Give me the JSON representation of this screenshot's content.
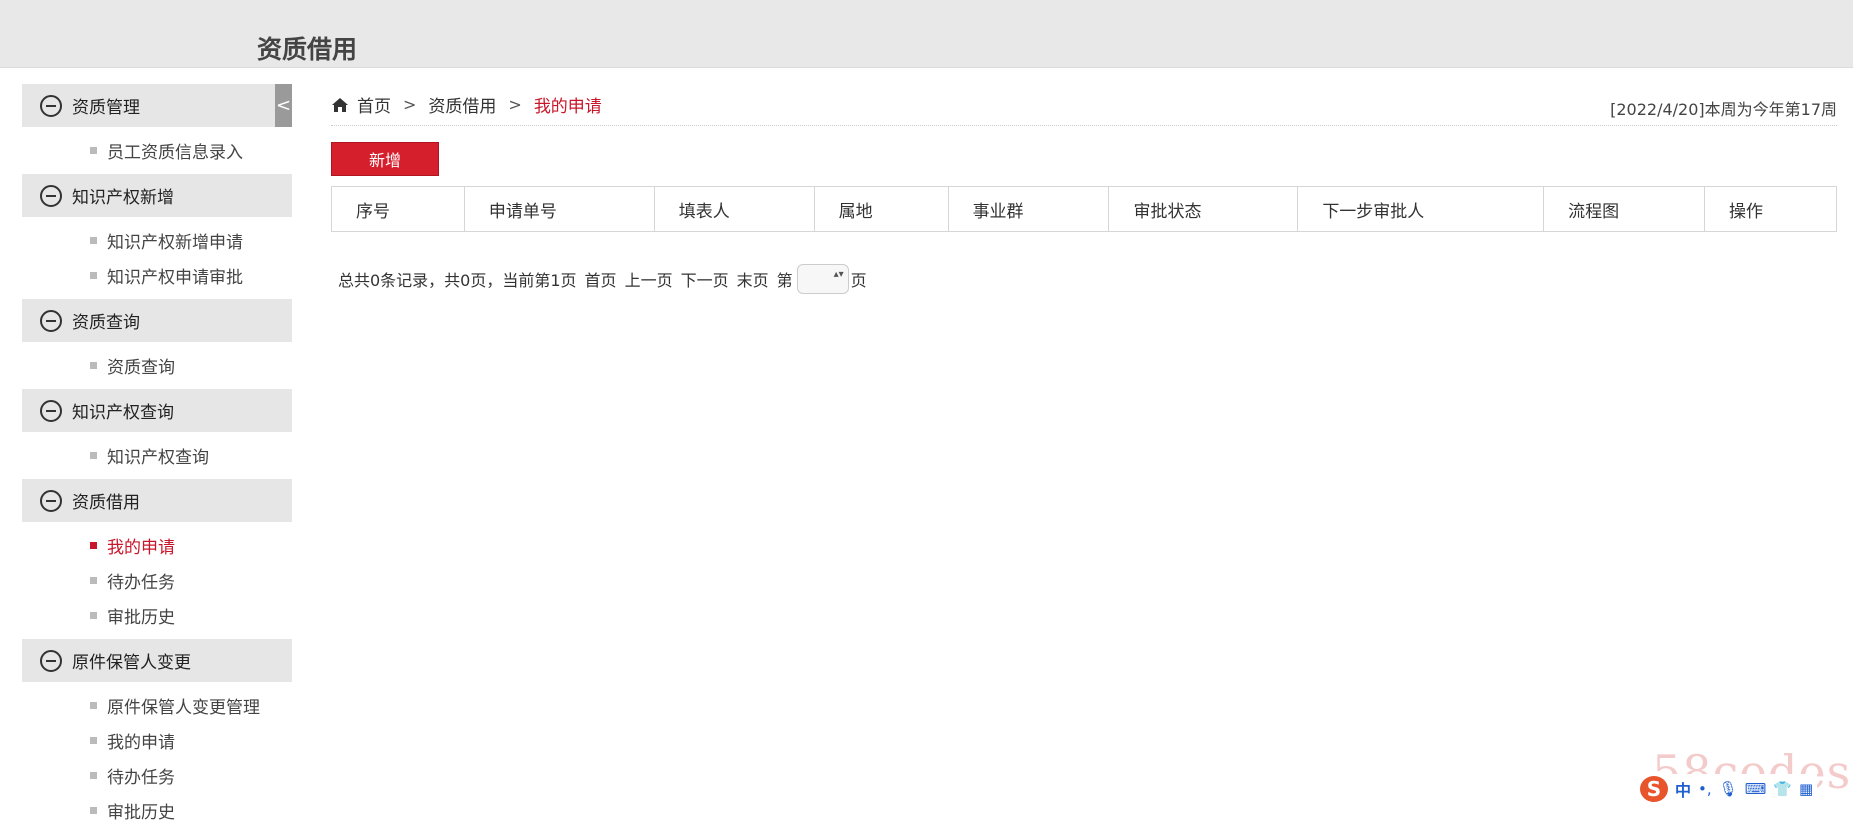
{
  "app_title": "资质借用",
  "sidebar": {
    "collapse_label": "<",
    "groups": [
      {
        "label": "资质管理",
        "items": [
          "员工资质信息录入"
        ]
      },
      {
        "label": "知识产权新增",
        "items": [
          "知识产权新增申请",
          "知识产权申请审批"
        ]
      },
      {
        "label": "资质查询",
        "items": [
          "资质查询"
        ]
      },
      {
        "label": "知识产权查询",
        "items": [
          "知识产权查询"
        ]
      },
      {
        "label": "资质借用",
        "items": [
          "我的申请",
          "待办任务",
          "审批历史"
        ]
      },
      {
        "label": "原件保管人变更",
        "items": [
          "原件保管人变更管理",
          "我的申请",
          "待办任务",
          "审批历史"
        ]
      }
    ],
    "active_item": "资质借用/我的申请"
  },
  "breadcrumb": {
    "home": "首页",
    "section": "资质借用",
    "current": "我的申请"
  },
  "week_info": "[2022/4/20]本周为今年第17周",
  "add_button": "新增",
  "table": {
    "columns": [
      "序号",
      "申请单号",
      "填表人",
      "属地",
      "事业群",
      "审批状态",
      "下一步审批人",
      "流程图",
      "操作"
    ],
    "rows": []
  },
  "pager": {
    "summary": "总共0条记录，共0页，当前第1页",
    "first": "首页",
    "prev": "上一页",
    "next": "下一页",
    "last": "末页",
    "page_prefix": "第",
    "page_suffix": "页"
  },
  "ime": {
    "mode": "中"
  },
  "watermark": "58codes",
  "colors": {
    "accent": "#d51f2c",
    "active_text": "#c8162a",
    "topbar": "#e8e8e8",
    "sidebar_header": "#e6e6e6"
  }
}
